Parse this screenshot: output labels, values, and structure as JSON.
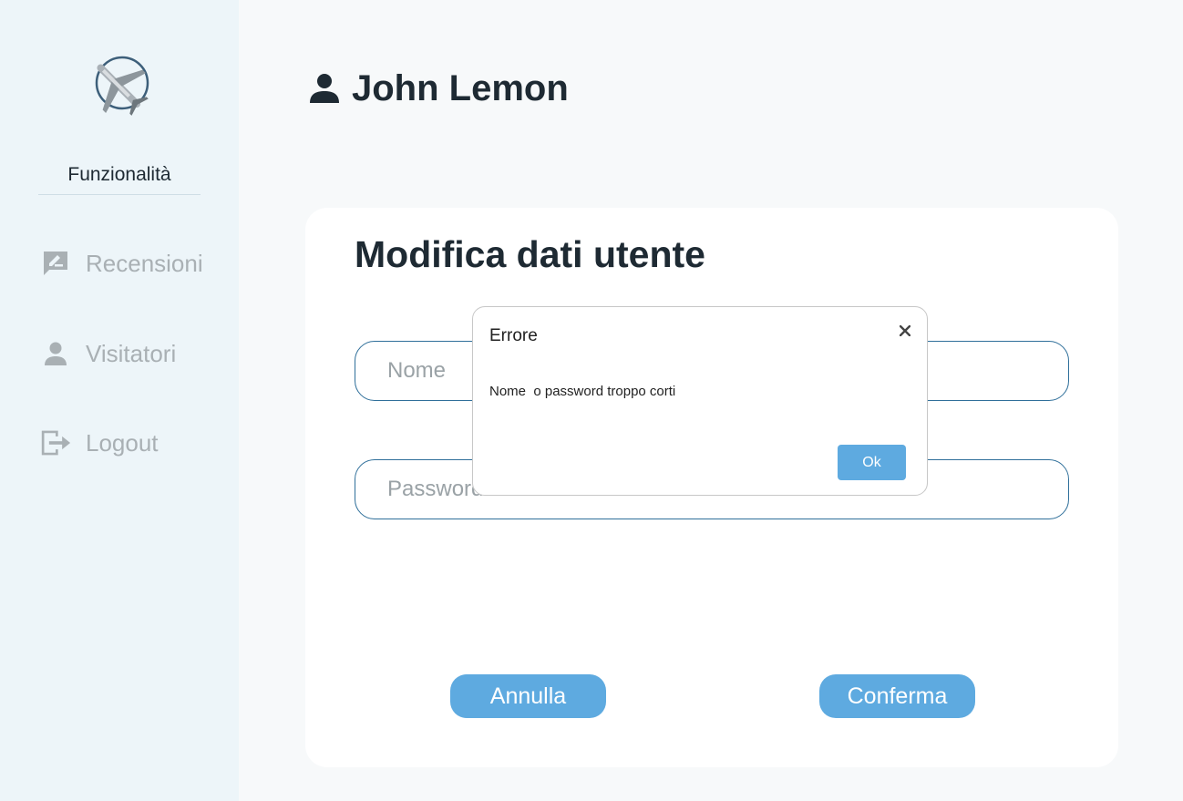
{
  "sidebar": {
    "heading": "Funzionalità",
    "items": [
      {
        "label": "Recensioni",
        "icon": "rate-review-icon"
      },
      {
        "label": "Visitatori",
        "icon": "person-icon"
      },
      {
        "label": "Logout",
        "icon": "logout-icon"
      }
    ]
  },
  "header": {
    "user_name": "John Lemon",
    "icon": "user-icon"
  },
  "form": {
    "title": "Modifica dati utente",
    "name_placeholder": "Nome",
    "password_placeholder": "Password:",
    "cancel_label": "Annulla",
    "confirm_label": "Conferma"
  },
  "dialog": {
    "title": "Errore",
    "message": "Nome  o password troppo corti",
    "ok_label": "Ok"
  },
  "colors": {
    "accent": "#5eaae0",
    "sidebar_bg": "#edf5f9",
    "text_dark": "#1e2a33",
    "muted": "#a9b0b4",
    "field_border": "#2f6f9a"
  }
}
